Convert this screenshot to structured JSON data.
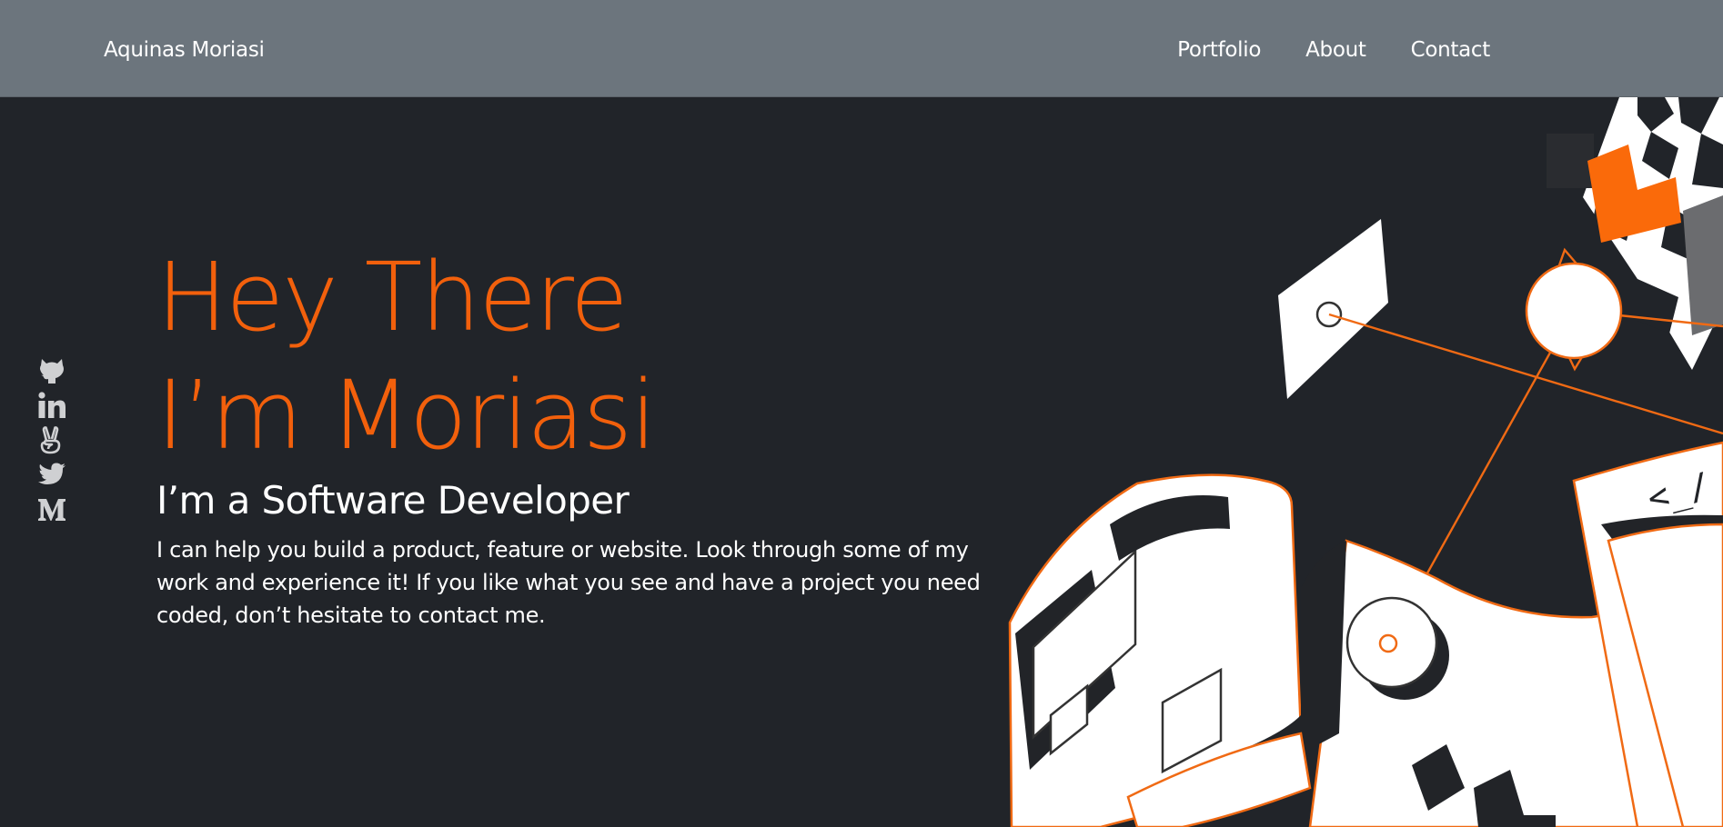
{
  "nav": {
    "brand": "Aquinas Moriasi",
    "links": [
      "Portfolio",
      "About",
      "Contact"
    ]
  },
  "socials": [
    {
      "name": "github",
      "icon": "github-icon"
    },
    {
      "name": "linkedin",
      "icon": "linkedin-icon"
    },
    {
      "name": "angellist",
      "icon": "angellist-icon"
    },
    {
      "name": "twitter",
      "icon": "twitter-icon"
    },
    {
      "name": "medium",
      "icon": "medium-icon"
    }
  ],
  "hero": {
    "title_line1": "Hey There",
    "title_line2": "I’m Moriasi",
    "subtitle": "I’m a Software Developer",
    "description": "I can help you build a product, feature or website. Look through some of my work and experience it! If you like what you see and have a project you need coded, don’t hesitate to contact me."
  },
  "illustration": {
    "code_text": "<_/"
  },
  "colors": {
    "navbar": "#6c757d",
    "background": "#212429",
    "accent": "#f2600c",
    "text": "#ffffff",
    "icon": "#cfd0d2"
  }
}
